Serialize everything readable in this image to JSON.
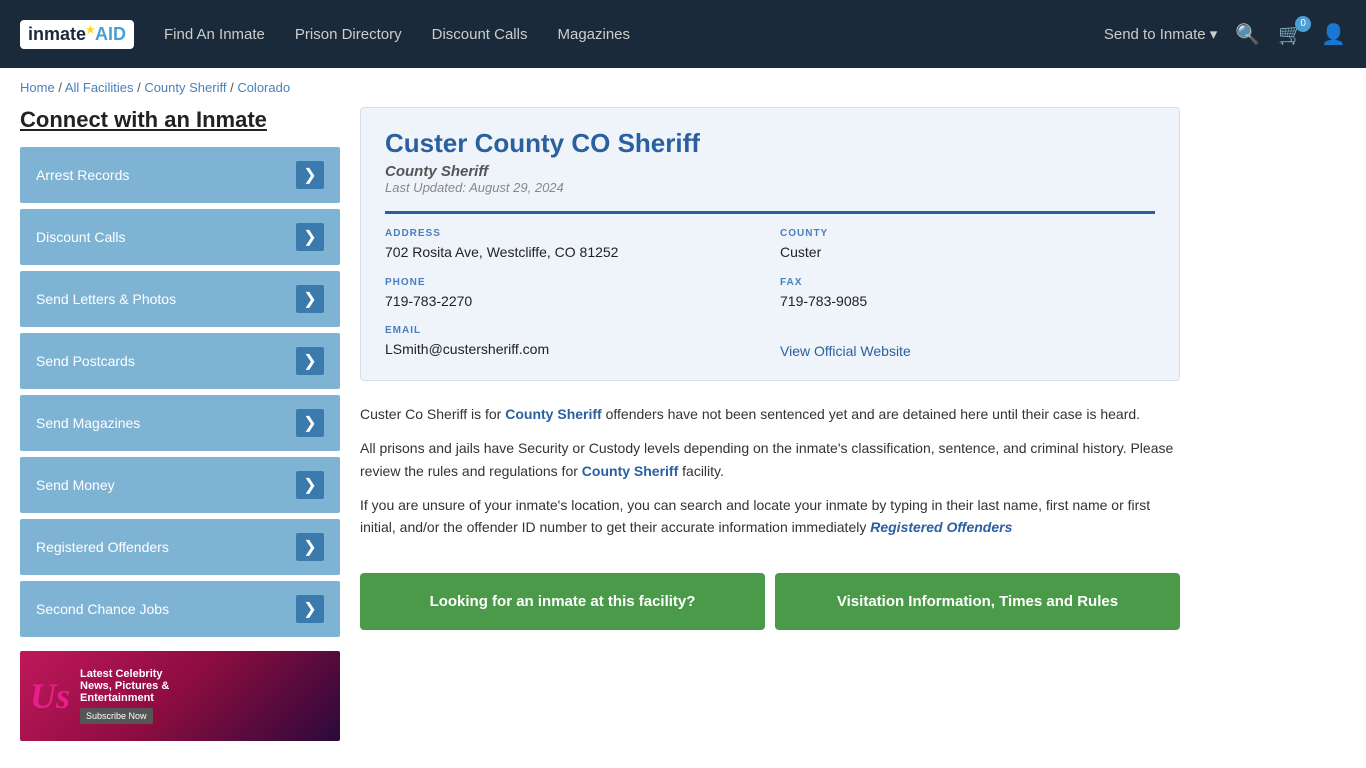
{
  "navbar": {
    "logo_text": "inmate",
    "logo_aid": "AID",
    "nav_links": [
      {
        "label": "Find An Inmate",
        "id": "find-an-inmate"
      },
      {
        "label": "Prison Directory",
        "id": "prison-directory"
      },
      {
        "label": "Discount Calls",
        "id": "discount-calls"
      },
      {
        "label": "Magazines",
        "id": "magazines"
      },
      {
        "label": "Send to Inmate ▾",
        "id": "send-to-inmate"
      }
    ],
    "cart_count": "0"
  },
  "breadcrumb": {
    "home": "Home",
    "separator1": " / ",
    "all_facilities": "All Facilities",
    "separator2": " / ",
    "county_sheriff": "County Sheriff",
    "separator3": " / ",
    "state": "Colorado"
  },
  "sidebar": {
    "title": "Connect with an Inmate",
    "menu_items": [
      {
        "label": "Arrest Records",
        "id": "arrest-records"
      },
      {
        "label": "Discount Calls",
        "id": "discount-calls"
      },
      {
        "label": "Send Letters & Photos",
        "id": "send-letters"
      },
      {
        "label": "Send Postcards",
        "id": "send-postcards"
      },
      {
        "label": "Send Magazines",
        "id": "send-magazines"
      },
      {
        "label": "Send Money",
        "id": "send-money"
      },
      {
        "label": "Registered Offenders",
        "id": "registered-offenders"
      },
      {
        "label": "Second Chance Jobs",
        "id": "second-chance-jobs"
      }
    ],
    "ad": {
      "logo": "Us",
      "line1": "Latest Celebrity",
      "line2": "News, Pictures &",
      "line3": "Entertainment",
      "subscribe": "Subscribe Now"
    }
  },
  "facility": {
    "name": "Custer County CO Sheriff",
    "type": "County Sheriff",
    "last_updated": "Last Updated: August 29, 2024",
    "address_label": "ADDRESS",
    "address_value": "702 Rosita Ave, Westcliffe, CO 81252",
    "county_label": "COUNTY",
    "county_value": "Custer",
    "phone_label": "PHONE",
    "phone_value": "719-783-2270",
    "fax_label": "FAX",
    "fax_value": "719-783-9085",
    "email_label": "EMAIL",
    "email_value": "LSmith@custersheriff.com",
    "website_label": "View Official Website",
    "website_url": "#"
  },
  "description": {
    "para1_pre": "Custer Co Sheriff is for ",
    "para1_link": "County Sheriff",
    "para1_post": " offenders have not been sentenced yet and are detained here until their case is heard.",
    "para2_pre": "All prisons and jails have Security or Custody levels depending on the inmate's classification, sentence, and criminal history. Please review the rules and regulations for ",
    "para2_link": "County Sheriff",
    "para2_post": " facility.",
    "para3_pre": "If you are unsure of your inmate's location, you can search and locate your inmate by typing in their last name, first name or first initial, and/or the offender ID number to get their accurate information immediately ",
    "para3_link": "Registered Offenders"
  },
  "bottom_buttons": {
    "btn1": "Looking for an inmate at this facility?",
    "btn2": "Visitation Information, Times and Rules"
  }
}
